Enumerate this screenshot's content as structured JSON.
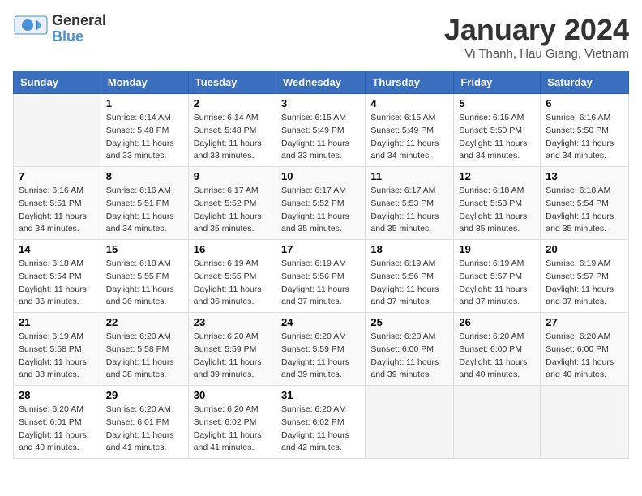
{
  "header": {
    "logo_general": "General",
    "logo_blue": "Blue",
    "month_title": "January 2024",
    "location": "Vi Thanh, Hau Giang, Vietnam"
  },
  "days_of_week": [
    "Sunday",
    "Monday",
    "Tuesday",
    "Wednesday",
    "Thursday",
    "Friday",
    "Saturday"
  ],
  "weeks": [
    [
      {
        "day": "",
        "info": ""
      },
      {
        "day": "1",
        "info": "Sunrise: 6:14 AM\nSunset: 5:48 PM\nDaylight: 11 hours\nand 33 minutes."
      },
      {
        "day": "2",
        "info": "Sunrise: 6:14 AM\nSunset: 5:48 PM\nDaylight: 11 hours\nand 33 minutes."
      },
      {
        "day": "3",
        "info": "Sunrise: 6:15 AM\nSunset: 5:49 PM\nDaylight: 11 hours\nand 33 minutes."
      },
      {
        "day": "4",
        "info": "Sunrise: 6:15 AM\nSunset: 5:49 PM\nDaylight: 11 hours\nand 34 minutes."
      },
      {
        "day": "5",
        "info": "Sunrise: 6:15 AM\nSunset: 5:50 PM\nDaylight: 11 hours\nand 34 minutes."
      },
      {
        "day": "6",
        "info": "Sunrise: 6:16 AM\nSunset: 5:50 PM\nDaylight: 11 hours\nand 34 minutes."
      }
    ],
    [
      {
        "day": "7",
        "info": "Sunrise: 6:16 AM\nSunset: 5:51 PM\nDaylight: 11 hours\nand 34 minutes."
      },
      {
        "day": "8",
        "info": "Sunrise: 6:16 AM\nSunset: 5:51 PM\nDaylight: 11 hours\nand 34 minutes."
      },
      {
        "day": "9",
        "info": "Sunrise: 6:17 AM\nSunset: 5:52 PM\nDaylight: 11 hours\nand 35 minutes."
      },
      {
        "day": "10",
        "info": "Sunrise: 6:17 AM\nSunset: 5:52 PM\nDaylight: 11 hours\nand 35 minutes."
      },
      {
        "day": "11",
        "info": "Sunrise: 6:17 AM\nSunset: 5:53 PM\nDaylight: 11 hours\nand 35 minutes."
      },
      {
        "day": "12",
        "info": "Sunrise: 6:18 AM\nSunset: 5:53 PM\nDaylight: 11 hours\nand 35 minutes."
      },
      {
        "day": "13",
        "info": "Sunrise: 6:18 AM\nSunset: 5:54 PM\nDaylight: 11 hours\nand 35 minutes."
      }
    ],
    [
      {
        "day": "14",
        "info": "Sunrise: 6:18 AM\nSunset: 5:54 PM\nDaylight: 11 hours\nand 36 minutes."
      },
      {
        "day": "15",
        "info": "Sunrise: 6:18 AM\nSunset: 5:55 PM\nDaylight: 11 hours\nand 36 minutes."
      },
      {
        "day": "16",
        "info": "Sunrise: 6:19 AM\nSunset: 5:55 PM\nDaylight: 11 hours\nand 36 minutes."
      },
      {
        "day": "17",
        "info": "Sunrise: 6:19 AM\nSunset: 5:56 PM\nDaylight: 11 hours\nand 37 minutes."
      },
      {
        "day": "18",
        "info": "Sunrise: 6:19 AM\nSunset: 5:56 PM\nDaylight: 11 hours\nand 37 minutes."
      },
      {
        "day": "19",
        "info": "Sunrise: 6:19 AM\nSunset: 5:57 PM\nDaylight: 11 hours\nand 37 minutes."
      },
      {
        "day": "20",
        "info": "Sunrise: 6:19 AM\nSunset: 5:57 PM\nDaylight: 11 hours\nand 37 minutes."
      }
    ],
    [
      {
        "day": "21",
        "info": "Sunrise: 6:19 AM\nSunset: 5:58 PM\nDaylight: 11 hours\nand 38 minutes."
      },
      {
        "day": "22",
        "info": "Sunrise: 6:20 AM\nSunset: 5:58 PM\nDaylight: 11 hours\nand 38 minutes."
      },
      {
        "day": "23",
        "info": "Sunrise: 6:20 AM\nSunset: 5:59 PM\nDaylight: 11 hours\nand 39 minutes."
      },
      {
        "day": "24",
        "info": "Sunrise: 6:20 AM\nSunset: 5:59 PM\nDaylight: 11 hours\nand 39 minutes."
      },
      {
        "day": "25",
        "info": "Sunrise: 6:20 AM\nSunset: 6:00 PM\nDaylight: 11 hours\nand 39 minutes."
      },
      {
        "day": "26",
        "info": "Sunrise: 6:20 AM\nSunset: 6:00 PM\nDaylight: 11 hours\nand 40 minutes."
      },
      {
        "day": "27",
        "info": "Sunrise: 6:20 AM\nSunset: 6:00 PM\nDaylight: 11 hours\nand 40 minutes."
      }
    ],
    [
      {
        "day": "28",
        "info": "Sunrise: 6:20 AM\nSunset: 6:01 PM\nDaylight: 11 hours\nand 40 minutes."
      },
      {
        "day": "29",
        "info": "Sunrise: 6:20 AM\nSunset: 6:01 PM\nDaylight: 11 hours\nand 41 minutes."
      },
      {
        "day": "30",
        "info": "Sunrise: 6:20 AM\nSunset: 6:02 PM\nDaylight: 11 hours\nand 41 minutes."
      },
      {
        "day": "31",
        "info": "Sunrise: 6:20 AM\nSunset: 6:02 PM\nDaylight: 11 hours\nand 42 minutes."
      },
      {
        "day": "",
        "info": ""
      },
      {
        "day": "",
        "info": ""
      },
      {
        "day": "",
        "info": ""
      }
    ]
  ]
}
